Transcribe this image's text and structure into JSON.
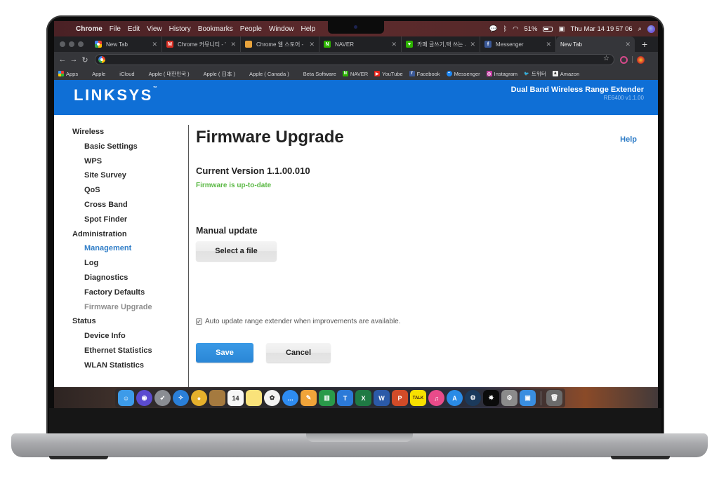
{
  "menubar": {
    "app": "Chrome",
    "items": [
      "File",
      "Edit",
      "View",
      "History",
      "Bookmarks",
      "People",
      "Window",
      "Help"
    ],
    "battery": "51%",
    "datetime": "Thu Mar 14  19 57 06"
  },
  "tabs": [
    {
      "title": "New Tab",
      "favicon": "google-icon",
      "color": "#ffffff",
      "active": false
    },
    {
      "title": "Chrome 커뮤니티 - 'N",
      "favicon": "gmail-icon",
      "color": "#d93025",
      "active": false
    },
    {
      "title": "Chrome 웹 스토어 - In",
      "favicon": "webstore-icon",
      "color": "#e8a33c",
      "active": false
    },
    {
      "title": "NAVER",
      "favicon": "naver-icon",
      "color": "#2db400",
      "active": false
    },
    {
      "title": "카페 글쓰기,택 쓰는 사람",
      "favicon": "cafe-icon",
      "color": "#2db400",
      "active": false
    },
    {
      "title": "Messenger",
      "favicon": "facebook-icon",
      "color": "#3b5998",
      "active": false
    },
    {
      "title": "New Tab",
      "favicon": "",
      "color": "",
      "active": true
    }
  ],
  "bookmarks": [
    {
      "label": "Apps",
      "icon": "apps-grid-icon"
    },
    {
      "label": "Apple",
      "icon": "apple-icon"
    },
    {
      "label": "iCloud",
      "icon": "apple-icon"
    },
    {
      "label": "Apple ( 대한민국 )",
      "icon": "apple-icon"
    },
    {
      "label": "Apple ( 日本 )",
      "icon": "apple-icon"
    },
    {
      "label": "Apple ( Canada )",
      "icon": "apple-icon"
    },
    {
      "label": "Beta Software",
      "icon": "apple-icon"
    },
    {
      "label": "NAVER",
      "icon": "naver-icon"
    },
    {
      "label": "YouTube",
      "icon": "youtube-icon"
    },
    {
      "label": "Facebook",
      "icon": "facebook-icon"
    },
    {
      "label": "Messenger",
      "icon": "messenger-icon"
    },
    {
      "label": "Instagram",
      "icon": "instagram-icon"
    },
    {
      "label": "트위터",
      "icon": "twitter-icon"
    },
    {
      "label": "Amazon",
      "icon": "amazon-icon"
    }
  ],
  "linksys": {
    "logo": "LINKSYS",
    "logo_tm": "™",
    "product": "Dual Band Wireless Range Extender",
    "model": "RE6400 v1.1.00",
    "brand_color": "#0f6fd6",
    "sidebar": [
      {
        "label": "Wireless",
        "type": "group"
      },
      {
        "label": "Basic Settings",
        "type": "item"
      },
      {
        "label": "WPS",
        "type": "item"
      },
      {
        "label": "Site Survey",
        "type": "item"
      },
      {
        "label": "QoS",
        "type": "item"
      },
      {
        "label": "Cross Band",
        "type": "item"
      },
      {
        "label": "Spot Finder",
        "type": "item"
      },
      {
        "label": "Administration",
        "type": "group"
      },
      {
        "label": "Management",
        "type": "item",
        "state": "hover"
      },
      {
        "label": "Log",
        "type": "item"
      },
      {
        "label": "Diagnostics",
        "type": "item"
      },
      {
        "label": "Factory Defaults",
        "type": "item"
      },
      {
        "label": "Firmware Upgrade",
        "type": "item",
        "state": "current"
      },
      {
        "label": "Status",
        "type": "group"
      },
      {
        "label": "Device Info",
        "type": "item"
      },
      {
        "label": "Ethernet Statistics",
        "type": "item"
      },
      {
        "label": "WLAN Statistics",
        "type": "item"
      }
    ],
    "main": {
      "title": "Firmware Upgrade",
      "help": "Help",
      "current_version": "Current Version 1.1.00.010",
      "status": "Firmware is up-to-date",
      "status_color": "#5cb946",
      "manual_update": "Manual update",
      "select_file": "Select a file",
      "auto_update_label": "Auto update range extender when improvements are available.",
      "auto_update_checked": true,
      "save": "Save",
      "cancel": "Cancel"
    }
  },
  "dock": [
    {
      "name": "finder-icon",
      "color": "#3d9be9",
      "glyph": "☺"
    },
    {
      "name": "siri-icon",
      "color": "#5b4bd0",
      "glyph": "◉"
    },
    {
      "name": "launchpad-icon",
      "color": "#8a8d93",
      "glyph": "➶"
    },
    {
      "name": "safari-icon",
      "color": "#2a7fd8",
      "glyph": "✧"
    },
    {
      "name": "chrome-icon",
      "color": "#e5b02c",
      "glyph": "●"
    },
    {
      "name": "contacts-icon",
      "color": "#a57a3f",
      "glyph": ""
    },
    {
      "name": "calendar-icon",
      "color": "#f7f7f7",
      "glyph": "14"
    },
    {
      "name": "notes-icon",
      "color": "#f9e27a",
      "glyph": ""
    },
    {
      "name": "photos-icon",
      "color": "#f2f2f2",
      "glyph": "✿"
    },
    {
      "name": "messages-icon",
      "color": "#2e8cf2",
      "glyph": "…"
    },
    {
      "name": "pages-icon",
      "color": "#f0a43a",
      "glyph": "✎"
    },
    {
      "name": "numbers-icon",
      "color": "#2a9a4a",
      "glyph": "▥"
    },
    {
      "name": "keynote-icon",
      "color": "#2c7ad8",
      "glyph": "T"
    },
    {
      "name": "excel-icon",
      "color": "#1f7a44",
      "glyph": "X"
    },
    {
      "name": "word-icon",
      "color": "#2b5aa8",
      "glyph": "W"
    },
    {
      "name": "powerpoint-icon",
      "color": "#d14b28",
      "glyph": "P"
    },
    {
      "name": "kakaotalk-icon",
      "color": "#f7e000",
      "glyph": "TALK"
    },
    {
      "name": "itunes-icon",
      "color": "#e94b8a",
      "glyph": "♫"
    },
    {
      "name": "app-store-icon",
      "color": "#2a8be6",
      "glyph": "A"
    },
    {
      "name": "steam-icon",
      "color": "#1b3a5c",
      "glyph": "⚙"
    },
    {
      "name": "battlenet-icon",
      "color": "#0b0b0b",
      "glyph": "✵"
    },
    {
      "name": "system-preferences-icon",
      "color": "#8b8b8b",
      "glyph": "⚙"
    },
    {
      "name": "parallels-icon",
      "color": "#3a8ee0",
      "glyph": "▣"
    },
    {
      "name": "trash-icon",
      "color": "#6b6b6b",
      "glyph": "🗑"
    }
  ]
}
